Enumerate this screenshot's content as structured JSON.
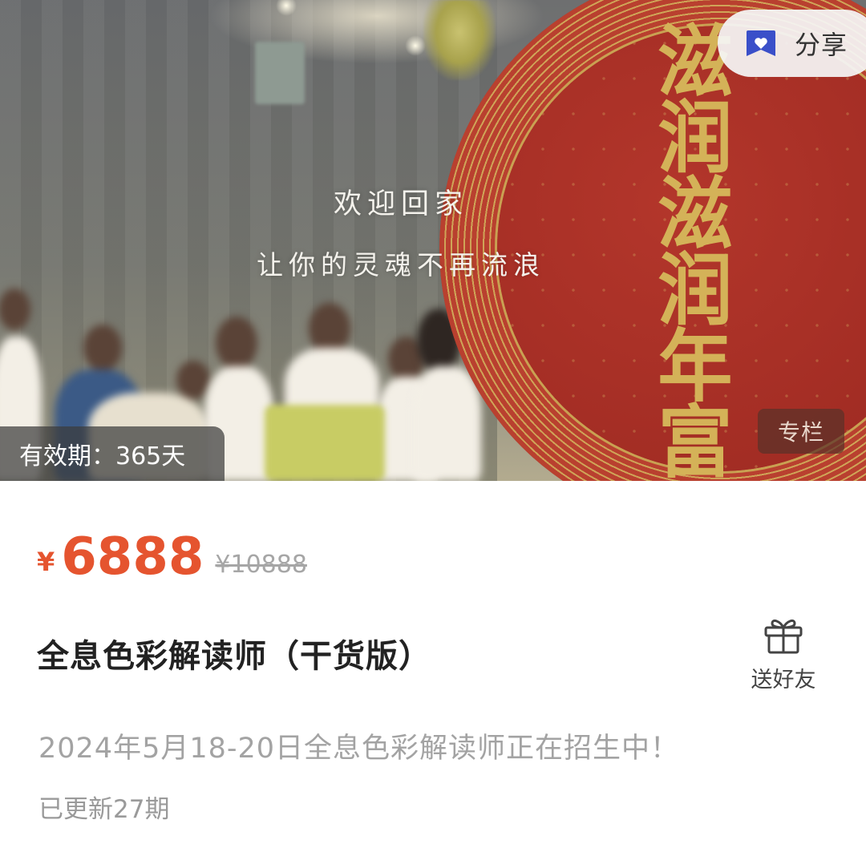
{
  "banner": {
    "welcome_line1": "欢迎回家",
    "welcome_line2": "让你的灵魂不再流浪",
    "calligraphy_text": "滋润滋润年富一年",
    "share_label": "分享",
    "share_icon": "share-heart-icon",
    "tag_label": "专栏",
    "validity_label": "有效期：365天"
  },
  "product": {
    "price_symbol": "¥",
    "price": "6888",
    "original_price": "¥10888",
    "title": "全息色彩解读师（干货版）",
    "subtitle": "2024年5月18-20日全息色彩解读师正在招生中！",
    "updates": "已更新27期"
  },
  "gift": {
    "label": "送好友",
    "icon": "gift-icon"
  },
  "colors": {
    "price": "#e5542f",
    "share_icon": "#3a4fc9",
    "disc_red": "#a6322a",
    "disc_gold": "#d4b258"
  }
}
